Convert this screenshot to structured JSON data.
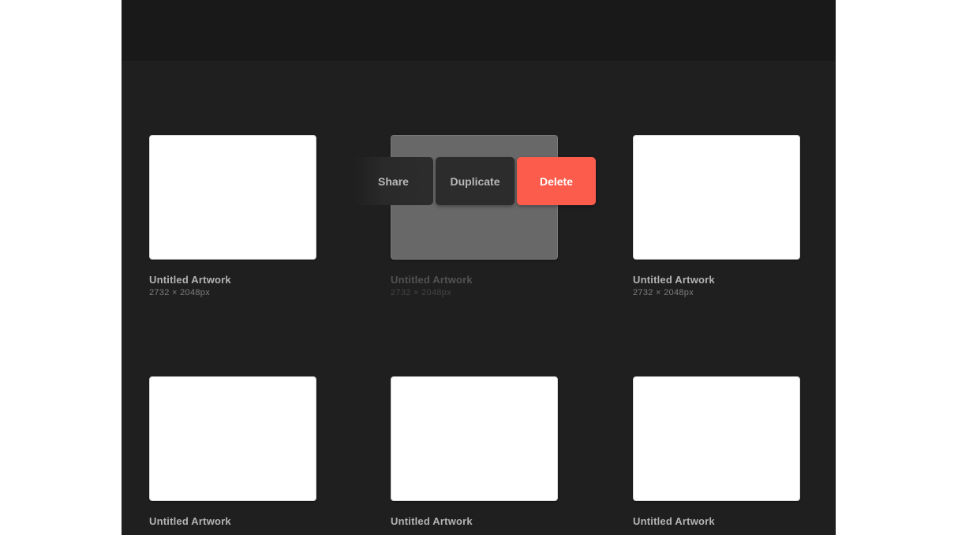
{
  "gallery": {
    "artworks": [
      {
        "title": "Untitled Artwork",
        "dims": "2732 × 2048px"
      },
      {
        "title": "Untitled Artwork",
        "dims": "2732 × 2048px"
      },
      {
        "title": "Untitled Artwork",
        "dims": "2732 × 2048px"
      },
      {
        "title": "Untitled Artwork",
        "dims": ""
      },
      {
        "title": "Untitled Artwork",
        "dims": ""
      },
      {
        "title": "Untitled Artwork",
        "dims": ""
      }
    ]
  },
  "action_menu": {
    "share_label": "Share",
    "duplicate_label": "Duplicate",
    "delete_label": "Delete"
  },
  "colors": {
    "background": "#1f1f1f",
    "topbar": "#191919",
    "delete_accent": "#fb5c4c"
  }
}
